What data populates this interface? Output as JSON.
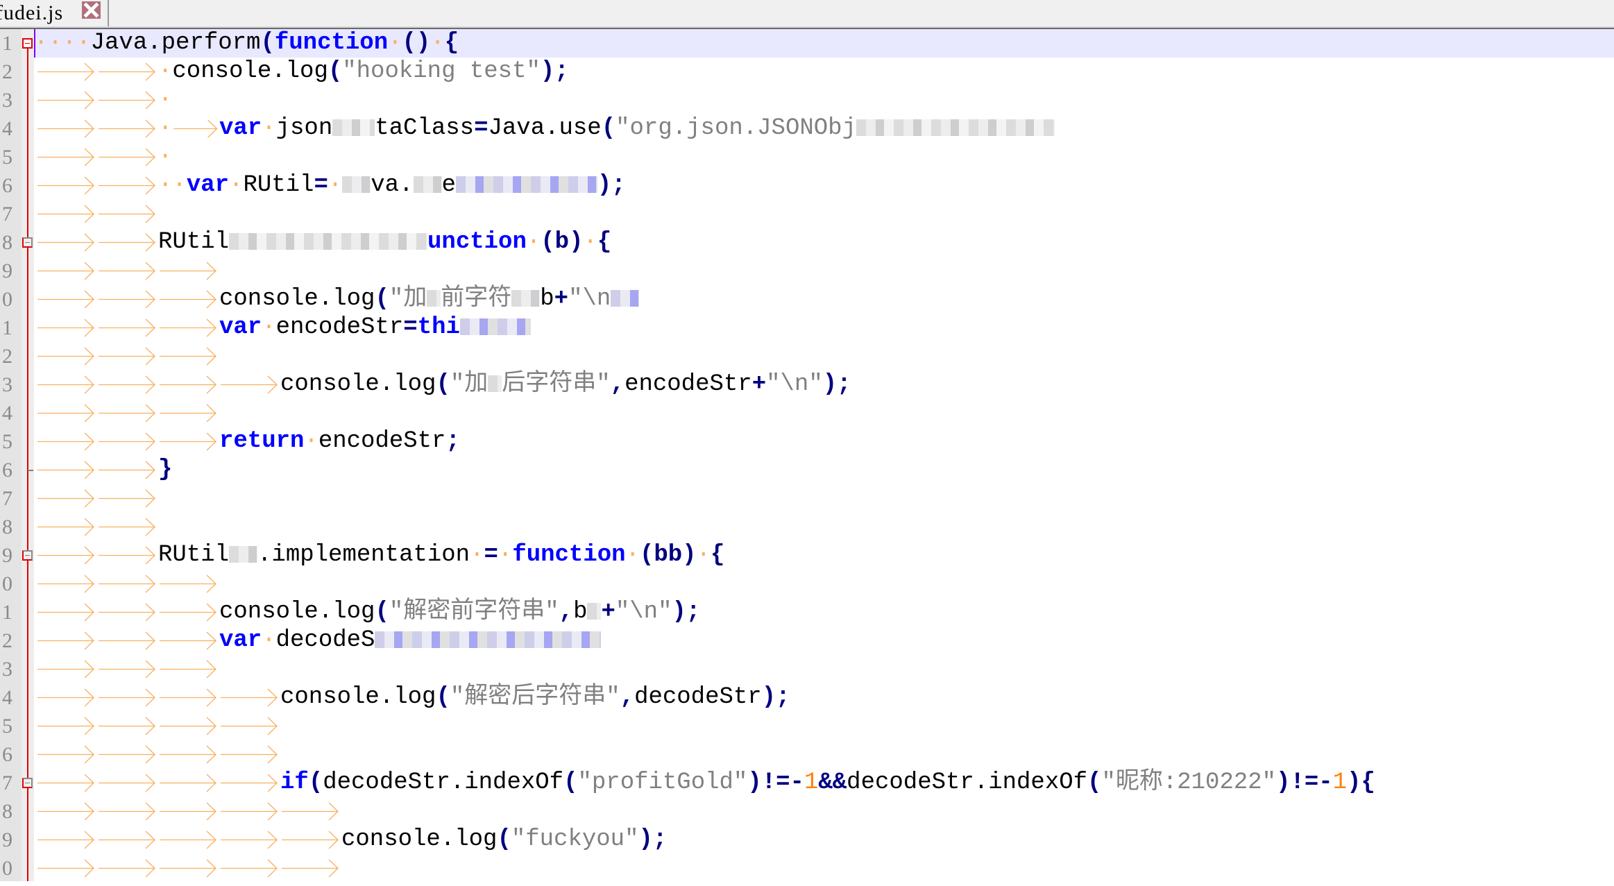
{
  "window": {
    "tab": {
      "label": "fudei.js",
      "close_icon": "close-icon"
    }
  },
  "colors": {
    "keyword": "#0000FF",
    "operator": "#000080",
    "string": "#808080",
    "number": "#FF8000",
    "whitespace_marker": "#F8B060",
    "current_line": "#E8E8FF",
    "fold_marker": "#E00000"
  },
  "editor": {
    "line_number_digits": [
      "1",
      "2",
      "3",
      "4",
      "5",
      "6",
      "7",
      "8",
      "9",
      "0",
      "1",
      "2",
      "3",
      "4",
      "5",
      "6",
      "7",
      "8",
      "9",
      "0",
      "1",
      "2",
      "3",
      "4",
      "5",
      "6",
      "7",
      "8",
      "9",
      "0"
    ],
    "lines": [
      {
        "tabs": 0,
        "lead": "····",
        "tokens": [
          [
            "t",
            "Java.perform"
          ],
          [
            "o",
            "("
          ],
          [
            "k",
            "function"
          ],
          [
            "t",
            "·"
          ],
          [
            "o",
            "()"
          ],
          [
            "t",
            "·"
          ],
          [
            "o",
            "{"
          ]
        ],
        "current": true,
        "fold": "start"
      },
      {
        "tabs": 2,
        "lead": "·",
        "tokens": [
          [
            "t",
            "console.log"
          ],
          [
            "o",
            "("
          ],
          [
            "s",
            "\"hooking·test\""
          ],
          [
            "o",
            ");"
          ]
        ]
      },
      {
        "tabs": 2,
        "lead": "·",
        "tokens": []
      },
      {
        "tabs": 2,
        "lead": "·",
        "extra_tab": true,
        "tokens": [
          [
            "k",
            "var"
          ],
          [
            "t",
            "·json"
          ],
          [
            "b",
            "",
            3
          ],
          [
            "t",
            "taClass"
          ],
          [
            "o",
            "="
          ],
          [
            "t",
            "Java.use"
          ],
          [
            "o",
            "("
          ],
          [
            "s",
            "\"org.json.JSONObj"
          ],
          [
            "b",
            "",
            14
          ]
        ]
      },
      {
        "tabs": 2,
        "lead": "·",
        "tokens": []
      },
      {
        "tabs": 2,
        "lead": "··",
        "tokens": [
          [
            "k",
            "var"
          ],
          [
            "t",
            "·RUtil"
          ],
          [
            "o",
            "="
          ],
          [
            "t",
            "·"
          ],
          [
            "b",
            "",
            2
          ],
          [
            "t",
            "va."
          ],
          [
            "b",
            "",
            2
          ],
          [
            "t",
            "e"
          ],
          [
            "b",
            "b",
            10
          ],
          [
            "o",
            ");"
          ]
        ]
      },
      {
        "tabs": 2,
        "lead": "",
        "tokens": []
      },
      {
        "tabs": 2,
        "lead": "",
        "tokens": [
          [
            "t",
            "RUtil"
          ],
          [
            "b",
            "",
            14
          ],
          [
            "k",
            "unction"
          ],
          [
            "t",
            "·"
          ],
          [
            "o",
            "(b)"
          ],
          [
            "t",
            "·"
          ],
          [
            "o",
            "{"
          ]
        ],
        "fold": "inner"
      },
      {
        "tabs": 3,
        "lead": "",
        "tokens": []
      },
      {
        "tabs": 3,
        "lead": "",
        "tokens": [
          [
            "t",
            "console.log"
          ],
          [
            "o",
            "("
          ],
          [
            "s",
            "\"加"
          ],
          [
            "b",
            "",
            1
          ],
          [
            "s",
            "前字符"
          ],
          [
            "b",
            "",
            2
          ],
          [
            "t",
            "b"
          ],
          [
            "o",
            "+"
          ],
          [
            "s",
            "\"\\n"
          ],
          [
            "b",
            "b",
            2
          ]
        ]
      },
      {
        "tabs": 3,
        "lead": "",
        "tokens": [
          [
            "k",
            "var"
          ],
          [
            "t",
            "·encodeStr"
          ],
          [
            "o",
            "="
          ],
          [
            "k",
            "thi"
          ],
          [
            "b",
            "b",
            5
          ]
        ]
      },
      {
        "tabs": 3,
        "lead": "",
        "tokens": []
      },
      {
        "tabs": 4,
        "lead": "",
        "tokens": [
          [
            "t",
            "console.log"
          ],
          [
            "o",
            "("
          ],
          [
            "s",
            "\"加"
          ],
          [
            "b",
            "",
            1
          ],
          [
            "s",
            "后字符串\""
          ],
          [
            "o",
            ","
          ],
          [
            "t",
            "encodeStr"
          ],
          [
            "o",
            "+"
          ],
          [
            "s",
            "\"\\n\""
          ],
          [
            "o",
            ");"
          ]
        ]
      },
      {
        "tabs": 3,
        "lead": "",
        "tokens": []
      },
      {
        "tabs": 3,
        "lead": "",
        "tokens": [
          [
            "k",
            "return"
          ],
          [
            "t",
            "·encodeStr"
          ],
          [
            "o",
            ";"
          ]
        ]
      },
      {
        "tabs": 2,
        "lead": "",
        "tokens": [
          [
            "o",
            "}"
          ]
        ],
        "fold": "end"
      },
      {
        "tabs": 2,
        "lead": "",
        "tokens": []
      },
      {
        "tabs": 2,
        "lead": "",
        "tokens": []
      },
      {
        "tabs": 2,
        "lead": "",
        "tokens": [
          [
            "t",
            "RUtil"
          ],
          [
            "b",
            "",
            2
          ],
          [
            "t",
            ".implementation·"
          ],
          [
            "o",
            "="
          ],
          [
            "t",
            "·"
          ],
          [
            "k",
            "function"
          ],
          [
            "t",
            "·"
          ],
          [
            "o",
            "(bb)"
          ],
          [
            "t",
            "·"
          ],
          [
            "o",
            "{"
          ]
        ],
        "fold": "inner"
      },
      {
        "tabs": 3,
        "lead": "",
        "tokens": []
      },
      {
        "tabs": 3,
        "lead": "",
        "tokens": [
          [
            "t",
            "console.log"
          ],
          [
            "o",
            "("
          ],
          [
            "s",
            "\"解密前字符串\""
          ],
          [
            "o",
            ","
          ],
          [
            "t",
            "b"
          ],
          [
            "b",
            "",
            1
          ],
          [
            "o",
            "+"
          ],
          [
            "s",
            "\"\\n\""
          ],
          [
            "o",
            ");"
          ]
        ]
      },
      {
        "tabs": 3,
        "lead": "",
        "tokens": [
          [
            "k",
            "var"
          ],
          [
            "t",
            "·decodeS"
          ],
          [
            "b",
            "b",
            16
          ]
        ]
      },
      {
        "tabs": 3,
        "lead": "",
        "tokens": []
      },
      {
        "tabs": 4,
        "lead": "",
        "tokens": [
          [
            "t",
            "console.log"
          ],
          [
            "o",
            "("
          ],
          [
            "s",
            "\"解密后字符串\""
          ],
          [
            "o",
            ","
          ],
          [
            "t",
            "decodeStr"
          ],
          [
            "o",
            ");"
          ]
        ]
      },
      {
        "tabs": 4,
        "lead": "",
        "tokens": []
      },
      {
        "tabs": 4,
        "lead": "",
        "tokens": []
      },
      {
        "tabs": 4,
        "lead": "",
        "tokens": [
          [
            "k",
            "if"
          ],
          [
            "o",
            "("
          ],
          [
            "t",
            "decodeStr.indexOf"
          ],
          [
            "o",
            "("
          ],
          [
            "s",
            "\"profitGold\""
          ],
          [
            "o",
            ")!=-"
          ],
          [
            "n",
            "1"
          ],
          [
            "o",
            "&&"
          ],
          [
            "t",
            "decodeStr.indexOf"
          ],
          [
            "o",
            "("
          ],
          [
            "s",
            "\"昵称:210222\""
          ],
          [
            "o",
            ")!=-"
          ],
          [
            "n",
            "1"
          ],
          [
            "o",
            "){"
          ]
        ],
        "fold": "inner"
      },
      {
        "tabs": 5,
        "lead": "",
        "tokens": []
      },
      {
        "tabs": 5,
        "lead": "",
        "tokens": [
          [
            "t",
            "console.log"
          ],
          [
            "o",
            "("
          ],
          [
            "s",
            "\"fuckyou\""
          ],
          [
            "o",
            ");"
          ]
        ]
      },
      {
        "tabs": 5,
        "lead": "",
        "tokens": []
      }
    ]
  }
}
